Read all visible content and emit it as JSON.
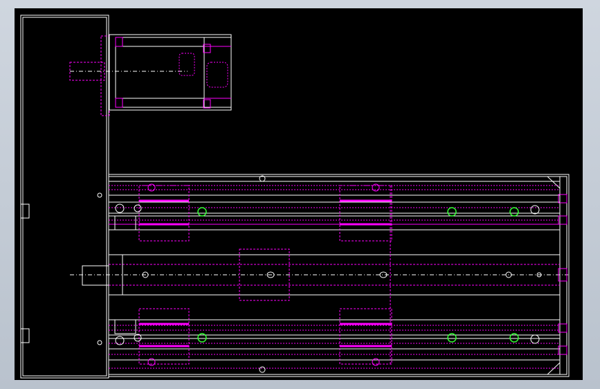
{
  "viewport": {
    "background": "#000000",
    "frame_color": "#c6ced8"
  },
  "colors": {
    "outline": "#ffffff",
    "hidden": "#ff00ff",
    "centerline": "#ffffff",
    "hole_mark": "#33ff33"
  },
  "views": {
    "side_plate": "side-plate-view",
    "motor": "motor-view",
    "linear_module": "linear-module-view"
  }
}
